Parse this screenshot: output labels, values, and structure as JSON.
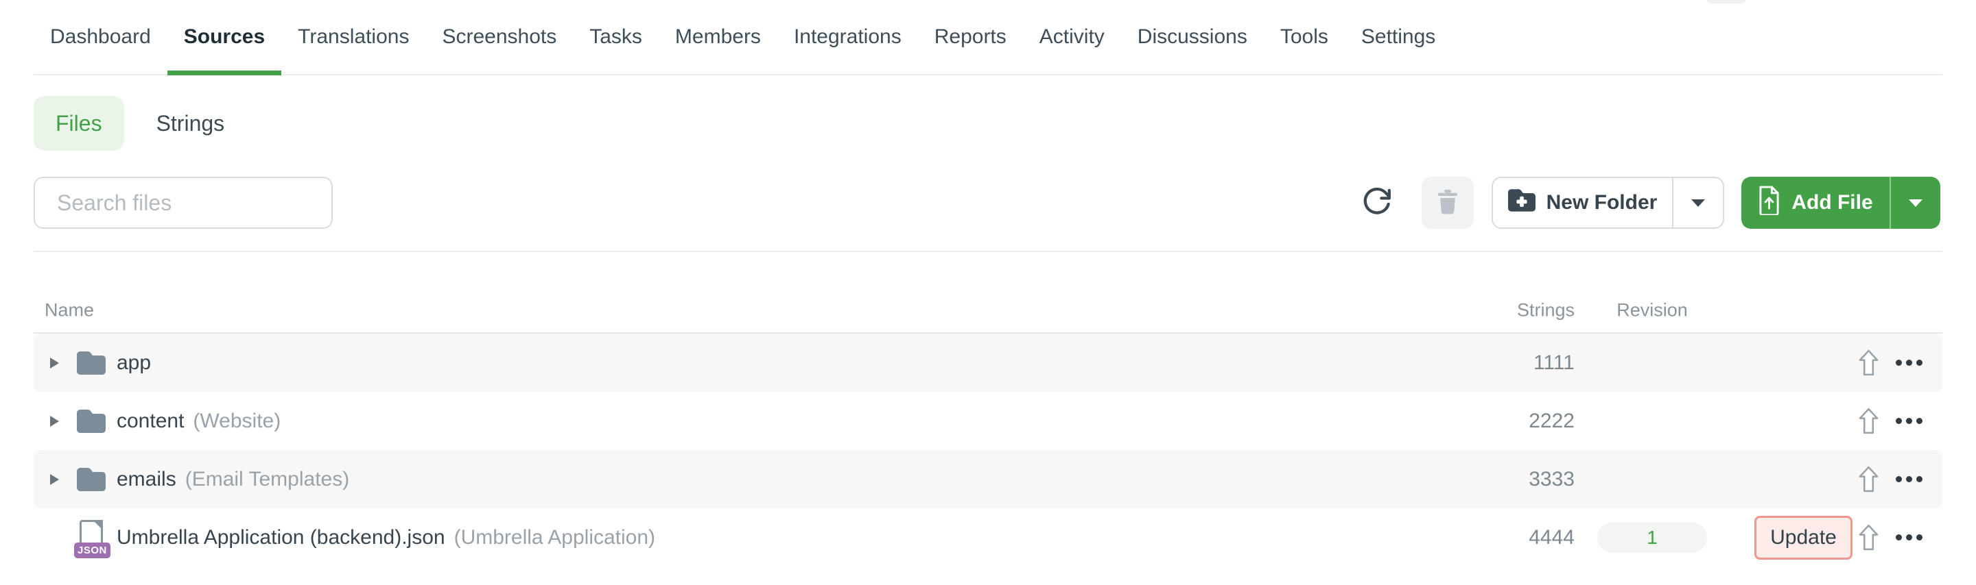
{
  "nav": {
    "items": [
      {
        "label": "Dashboard",
        "active": false
      },
      {
        "label": "Sources",
        "active": true
      },
      {
        "label": "Translations",
        "active": false
      },
      {
        "label": "Screenshots",
        "active": false
      },
      {
        "label": "Tasks",
        "active": false
      },
      {
        "label": "Members",
        "active": false
      },
      {
        "label": "Integrations",
        "active": false
      },
      {
        "label": "Reports",
        "active": false
      },
      {
        "label": "Activity",
        "active": false
      },
      {
        "label": "Discussions",
        "active": false
      },
      {
        "label": "Tools",
        "active": false
      },
      {
        "label": "Settings",
        "active": false
      }
    ]
  },
  "view_toggle": {
    "files_label": "Files",
    "strings_label": "Strings",
    "active": "Files"
  },
  "toolbar": {
    "search_placeholder": "Search files",
    "new_folder_label": "New Folder",
    "add_file_label": "Add File"
  },
  "table": {
    "headers": {
      "name": "Name",
      "strings": "Strings",
      "revision": "Revision"
    },
    "rows": [
      {
        "kind": "folder",
        "name": "app",
        "note": "",
        "strings": "1111"
      },
      {
        "kind": "folder",
        "name": "content",
        "note": "(Website)",
        "strings": "2222"
      },
      {
        "kind": "folder",
        "name": "emails",
        "note": "(Email Templates)",
        "strings": "3333"
      },
      {
        "kind": "file",
        "name": "Umbrella Application (backend).json",
        "note": "(Umbrella Application)",
        "strings": "4444",
        "revision": "1",
        "badge": "JSON",
        "update_label": "Update"
      }
    ]
  },
  "icons": {
    "refresh": "circular-arrow",
    "trash": "trash-can",
    "new_folder": "folder-plus",
    "add_file": "file-with-up-arrow",
    "dropdown": "caret-down",
    "expand": "caret-right",
    "folder": "folder",
    "upload": "hollow-up-arrow",
    "more": "ellipsis"
  },
  "colors": {
    "accent_green": "#43a047",
    "files_pill_bg": "#e9f5e9",
    "update_border": "#f2958e",
    "update_bg": "#fdecea",
    "folder_icon": "#7d8c99",
    "json_badge": "#9d6fb0",
    "row_alt_bg": "#f7f7f7"
  }
}
